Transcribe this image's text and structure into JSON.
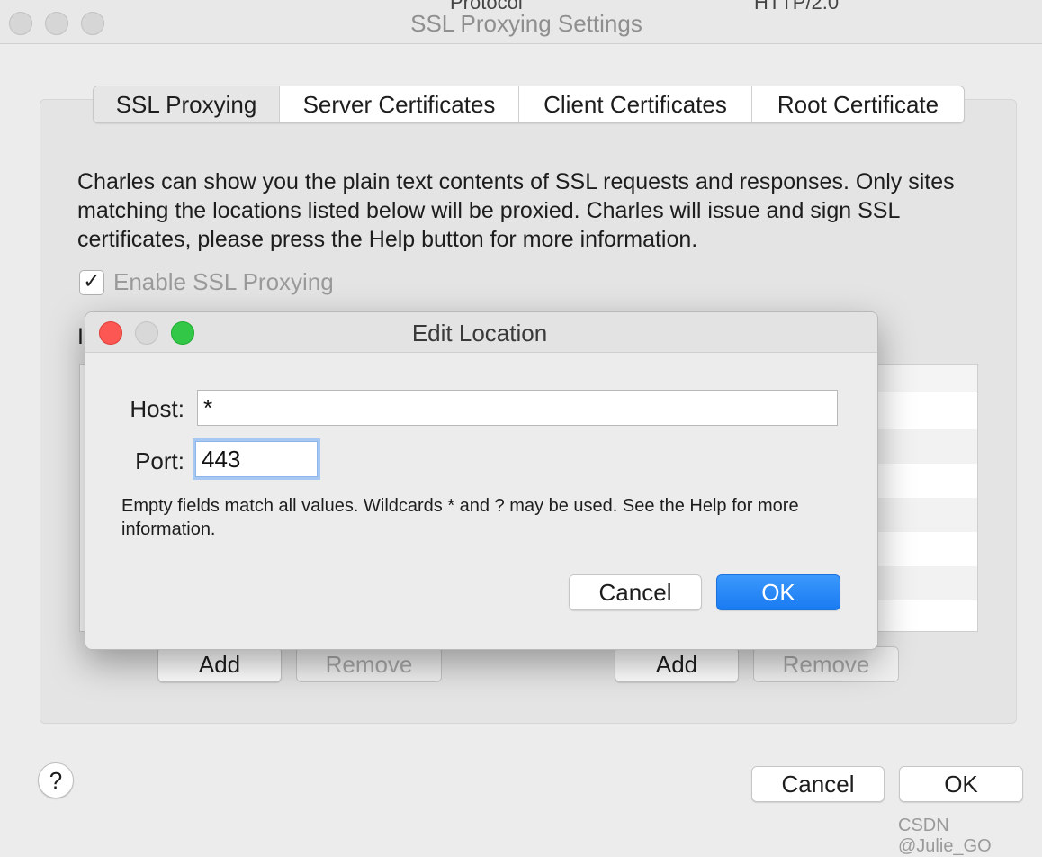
{
  "window": {
    "title": "SSL Proxying Settings",
    "background_clip_1": "Protocol",
    "background_clip_2": "HTTP/2.0"
  },
  "tabs": [
    {
      "label": "SSL Proxying",
      "selected": true
    },
    {
      "label": "Server Certificates",
      "selected": false
    },
    {
      "label": "Client Certificates",
      "selected": false
    },
    {
      "label": "Root Certificate",
      "selected": false
    }
  ],
  "description": "Charles can show you the plain text contents of SSL requests and responses. Only sites matching the locations listed below will be proxied. Charles will issue and sign SSL certificates, please press the Help button for more information.",
  "enable_checkbox": {
    "label": "Enable SSL Proxying",
    "checked": true
  },
  "include_label_fragment": "I",
  "left_panel": {
    "add_label": "Add",
    "remove_label": "Remove"
  },
  "right_panel": {
    "add_label": "Add",
    "remove_label": "Remove"
  },
  "footer": {
    "cancel_label": "Cancel",
    "ok_label": "OK",
    "help_label": "?"
  },
  "dialog": {
    "title": "Edit Location",
    "host_label": "Host:",
    "host_value": "*",
    "port_label": "Port:",
    "port_value": "443",
    "hint": "Empty fields match all values. Wildcards * and ? may be used. See the Help for more information.",
    "cancel_label": "Cancel",
    "ok_label": "OK"
  },
  "watermark": "CSDN @Julie_GO",
  "colors": {
    "accent": "#1a7bf2",
    "close": "#fc5753",
    "zoom": "#33c748"
  }
}
